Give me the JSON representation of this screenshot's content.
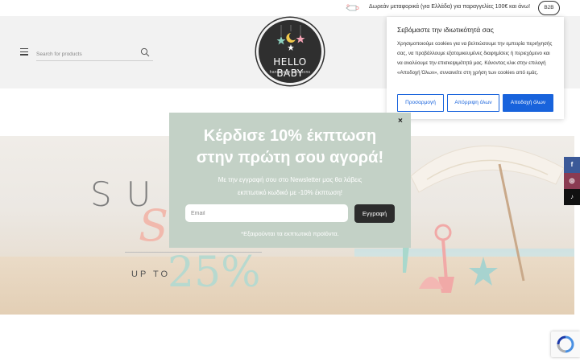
{
  "topbar": {
    "shipping_text": "Δωρεάν μεταφορικά (για Ελλάδα) για παραγγελίες 100€ και άνω!",
    "b2b_label": "B2B"
  },
  "header": {
    "search_placeholder": "Search for products",
    "logo_title": "HELLO BABY",
    "logo_subtitle": "handmade creations"
  },
  "cookie": {
    "title": "Σεβόμαστε την ιδιωτικότητά σας",
    "text": "Χρησιμοποιούμε cookies για να βελτιώσουμε την εμπειρία περιήγησής σας, να προβάλλουμε εξατομικευμένες διαφημίσεις ή περιεχόμενο και να αναλύουμε την επισκεψιμότητά μας. Κάνοντας κλικ στην επιλογή «Αποδοχή Όλων», συναινείτε στη χρήση των cookies από εμάς.",
    "customize_label": "Προσαρμογή",
    "reject_label": "Απόρριψη όλων",
    "accept_label": "Αποδοχή όλων"
  },
  "hero": {
    "sum_text": "SUM",
    "script_text": "S",
    "upto_text": "UP TO",
    "percent_text": "25%"
  },
  "popup": {
    "close_label": "×",
    "headline_line1": "Κέρδισε 10% έκπτωση",
    "headline_line2": "στην πρώτη σου αγορά!",
    "body_line1": "Με την εγγραφή σου στο Newsletter μας θα λάβεις",
    "body_line2": "εκπτωτικό κωδικό με -10% έκπτωση!",
    "email_placeholder": "Email",
    "signup_label": "Εγγραφή",
    "note": "*Εξαιρούνται τα εκπτωτικά προϊόντα."
  },
  "social": {
    "facebook_icon": "f",
    "instagram_icon": "◎",
    "tiktok_icon": "♪"
  },
  "colors": {
    "cookie_accent": "#1863dc",
    "popup_bg": "#c3d1c6",
    "signup_bg": "#2c2c2c"
  }
}
